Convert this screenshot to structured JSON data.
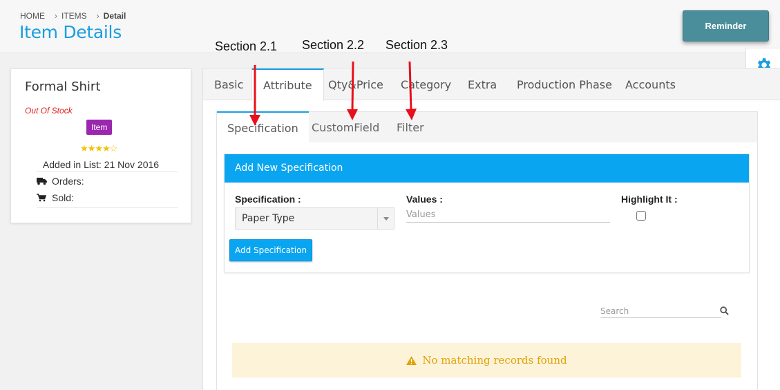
{
  "breadcrumb": {
    "home": "HOME",
    "items": "ITEMS",
    "current": "Detail"
  },
  "page": {
    "title": "Item Details"
  },
  "header": {
    "reminder_label": "Reminder"
  },
  "annotations": [
    "Section 2.1",
    "Section 2.2",
    "Section 2.3"
  ],
  "product": {
    "name": "Formal Shirt",
    "stock_status": "Out Of Stock",
    "type_badge": "Item",
    "rating": 4,
    "rating_max": 5,
    "added_label": "Added in List:",
    "added_date": "21 Nov 2016",
    "orders_label": "Orders:",
    "sold_label": "Sold:"
  },
  "tabs": [
    "Basic",
    "Attribute",
    "Qty&Price",
    "Category",
    "Extra",
    "Production Phase",
    "Accounts"
  ],
  "active_tab": "Attribute",
  "subtabs": [
    "Specification",
    "CustomField",
    "Filter"
  ],
  "active_subtab": "Specification",
  "form": {
    "heading": "Add New Specification",
    "specification_label": "Specification :",
    "specification_value": "Paper Type",
    "values_label": "Values :",
    "values_placeholder": "Values",
    "highlight_label": "Highlight It :",
    "highlight_checked": false,
    "submit_label": "Add Specification"
  },
  "table": {
    "search_placeholder": "Search",
    "empty_message": "No matching records found"
  },
  "colors": {
    "accent": "#1a9ee0",
    "header_blue": "#0aa5f0",
    "badge_purple": "#9b27af",
    "reminder": "#4a8e9c",
    "warning": "#e0a107",
    "out_of_stock": "#e21a1a",
    "arrow": "#e8101a"
  },
  "icons": {
    "gear": "gear-icon",
    "orders": "truck-icon",
    "sold": "cart-icon",
    "search": "search-icon",
    "warning": "warning-icon",
    "dropdown": "caret-down-icon"
  }
}
